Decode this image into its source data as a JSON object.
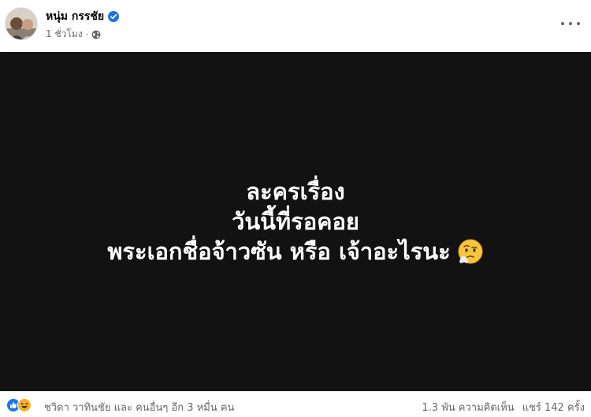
{
  "post": {
    "author_name": "หนุ่ม กรรชัย",
    "timestamp": "1 ชั่วโมง",
    "separator": "·",
    "privacy_icon": "globe-icon",
    "verified_icon": "verified-badge-icon",
    "more_icon": "more-options-icon"
  },
  "media": {
    "lines": [
      "ละครเรื่อง",
      "วันนี้ที่รอคอย",
      "พระเอกชื่อจ้าวซัน หรือ เจ้าอะไรนะ"
    ],
    "trailing_emoji": "face-with-raised-eyebrow-emoji"
  },
  "footer": {
    "reaction_icons": [
      "like-reaction-icon",
      "haha-reaction-icon"
    ],
    "reaction_text": "ชวิดา วาทินชัย และ คนอื่นๆ อีก 3 หมื่น คน",
    "comments": "1.3 พัน ความคิดเห็น",
    "shares": "แชร์ 142 ครั้ง"
  },
  "colors": {
    "media_background": "#121212",
    "secondary_text": "#65676b",
    "verified": "#1b74e4",
    "like": "#1877f2",
    "haha": "#f7b125"
  }
}
